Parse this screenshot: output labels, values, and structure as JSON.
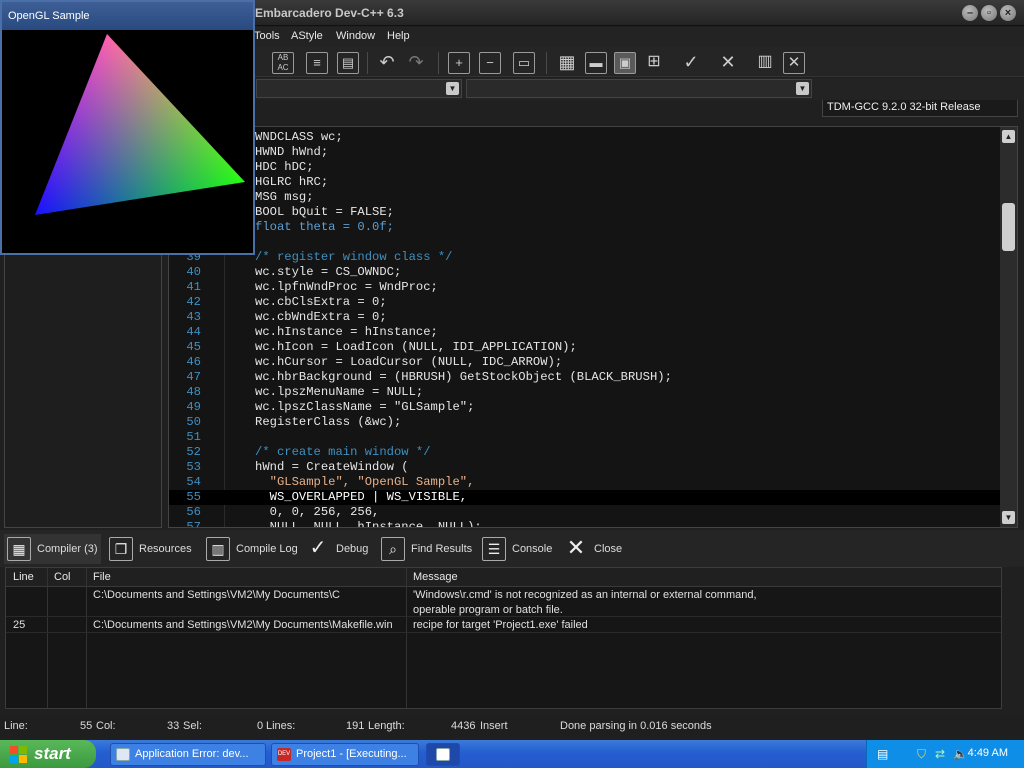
{
  "ide": {
    "title": "Embarcadero Dev-C++ 6.3",
    "menu": [
      "Tools",
      "AStyle",
      "Window",
      "Help"
    ],
    "compiler": "TDM-GCC 9.2.0 32-bit Release"
  },
  "code_lines": [
    {
      "num": "",
      "text": "WNDCLASS wc;"
    },
    {
      "num": "",
      "text": "HWND hWnd;"
    },
    {
      "num": "",
      "text": "HDC hDC;"
    },
    {
      "num": "",
      "text": "HGLRC hRC;"
    },
    {
      "num": "",
      "text": "MSG msg;"
    },
    {
      "num": "",
      "text": "BOOL bQuit = FALSE;"
    },
    {
      "num": "",
      "text": "float theta = 0.0f;"
    },
    {
      "num": "",
      "text": ""
    },
    {
      "num": "39",
      "text": "/* register window class */"
    },
    {
      "num": "40",
      "text": "wc.style = CS_OWNDC;"
    },
    {
      "num": "41",
      "text": "wc.lpfnWndProc = WndProc;"
    },
    {
      "num": "42",
      "text": "wc.cbClsExtra = 0;"
    },
    {
      "num": "43",
      "text": "wc.cbWndExtra = 0;"
    },
    {
      "num": "44",
      "text": "wc.hInstance = hInstance;"
    },
    {
      "num": "45",
      "text": "wc.hIcon = LoadIcon (NULL, IDI_APPLICATION);"
    },
    {
      "num": "46",
      "text": "wc.hCursor = LoadCursor (NULL, IDC_ARROW);"
    },
    {
      "num": "47",
      "text": "wc.hbrBackground = (HBRUSH) GetStockObject (BLACK_BRUSH);"
    },
    {
      "num": "48",
      "text": "wc.lpszMenuName = NULL;"
    },
    {
      "num": "49",
      "text": "wc.lpszClassName = \"GLSample\";"
    },
    {
      "num": "50",
      "text": "RegisterClass (&wc);"
    },
    {
      "num": "51",
      "text": ""
    },
    {
      "num": "52",
      "text": "/* create main window */"
    },
    {
      "num": "53",
      "text": "hWnd = CreateWindow ("
    },
    {
      "num": "54",
      "text": "  \"GLSample\", \"OpenGL Sample\","
    },
    {
      "num": "55",
      "text": "  WS_OVERLAPPED | WS_VISIBLE,"
    },
    {
      "num": "56",
      "text": "  0, 0, 256, 256,"
    },
    {
      "num": "57",
      "text": "  NULL, NULL, hInstance, NULL);"
    }
  ],
  "bottom_tabs": [
    "Compiler (3)",
    "Resources",
    "Compile Log",
    "Debug",
    "Find Results",
    "Console",
    "Close"
  ],
  "results": {
    "headers": [
      "Line",
      "Col",
      "File",
      "Message"
    ],
    "rows": [
      {
        "line": "",
        "col": "",
        "file": "C:\\Documents and Settings\\VM2\\My Documents\\C",
        "message": "'Windows\\r.cmd' is not recognized as an internal or external command,",
        "message2": "operable program or batch file."
      },
      {
        "line": "25",
        "col": "",
        "file": "C:\\Documents and Settings\\VM2\\My Documents\\Makefile.win",
        "message": "recipe for target 'Project1.exe' failed",
        "message2": ""
      }
    ]
  },
  "status": {
    "line_label": "Line:",
    "line_value": "55",
    "col_label": "Col:",
    "col_value": "33",
    "sel_label": "Sel:",
    "sel_value": "0",
    "lines_label": "Lines:",
    "lines_value": "191",
    "length_label": "Length:",
    "length_value": "4436",
    "mode": "Insert",
    "message": "Done parsing in 0.016 seconds"
  },
  "gl_window": {
    "title": "OpenGL Sample"
  },
  "taskbar": {
    "start": "start",
    "items": [
      "Application Error: dev...",
      "Project1 - [Executing..."
    ],
    "clock": "4:49 AM"
  },
  "colors": {
    "code_keyword": "#5a9fd6",
    "code_comment": "#3f8fc0",
    "code_string": "#e8b088",
    "code_number": "#f0c040"
  }
}
